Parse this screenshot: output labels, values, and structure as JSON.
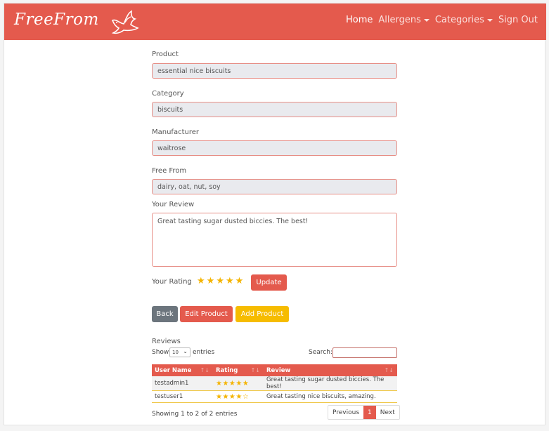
{
  "brand": "FreeFrom",
  "nav": {
    "home": "Home",
    "allergens": "Allergens",
    "categories": "Categories",
    "signout": "Sign Out"
  },
  "form": {
    "product_label": "Product",
    "product_value": "essential nice biscuits",
    "category_label": "Category",
    "category_value": "biscuits",
    "manufacturer_label": "Manufacturer",
    "manufacturer_value": "waitrose",
    "freefrom_label": "Free From",
    "freefrom_value": "dairy, oat, nut, soy",
    "review_label": "Your Review",
    "review_value": "Great tasting sugar dusted biccies. The best!",
    "rating_label": "Your Rating",
    "rating_value": 5,
    "update_label": "Update"
  },
  "actions": {
    "back": "Back",
    "edit": "Edit Product",
    "add": "Add Product"
  },
  "reviews": {
    "title": "Reviews",
    "show": "Show",
    "entries_count": "10",
    "entries": "entries",
    "search": "Search:",
    "columns": [
      "User Name",
      "Rating",
      "Review"
    ],
    "rows": [
      {
        "user": "testadmin1",
        "stars": "★★★★★",
        "review": "Great tasting sugar dusted biccies. The best!"
      },
      {
        "user": "testuser1",
        "stars": "★★★★☆",
        "review": "Great tasting nice biscuits, amazing."
      }
    ],
    "info": "Showing 1 to 2 of 2 entries",
    "prev": "Previous",
    "page": "1",
    "next": "Next"
  },
  "colors": {
    "accent": "#e45a4d",
    "star": "#f4b400"
  }
}
